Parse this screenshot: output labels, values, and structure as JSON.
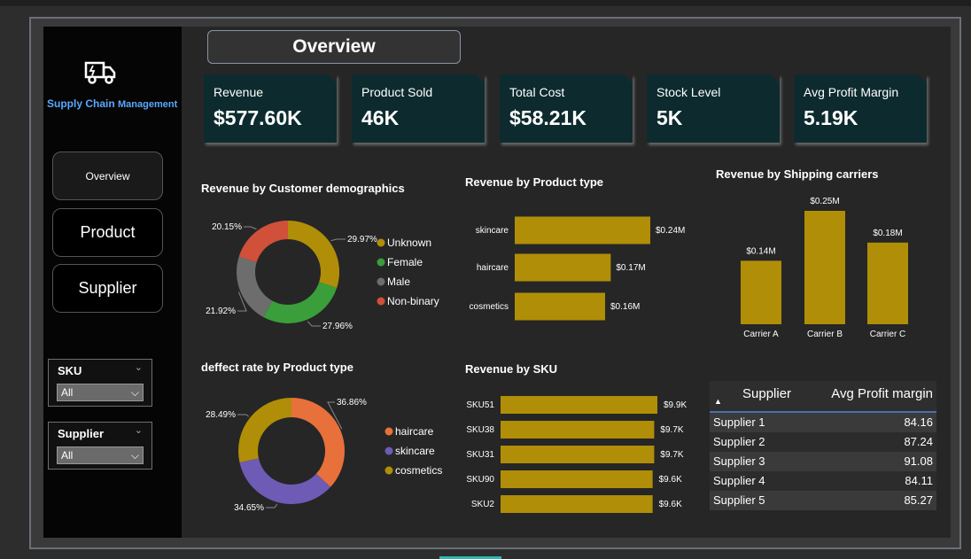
{
  "page": {
    "title": "Overview"
  },
  "brand": {
    "name": "Supply Chain",
    "sub": "Management",
    "icon": "delivery-truck-icon"
  },
  "nav": [
    {
      "label": "Overview",
      "active": true
    },
    {
      "label": "Product",
      "active": false
    },
    {
      "label": "Supplier",
      "active": false
    }
  ],
  "slicers": [
    {
      "label": "SKU",
      "value": "All"
    },
    {
      "label": "Supplier",
      "value": "All"
    }
  ],
  "kpis": [
    {
      "title": "Revenue",
      "value": "$577.60K"
    },
    {
      "title": "Product Sold",
      "value": "46K"
    },
    {
      "title": "Total Cost",
      "value": "$58.21K"
    },
    {
      "title": "Stock Level",
      "value": "5K"
    },
    {
      "title": "Avg Profit Margin",
      "value": "5.19K"
    }
  ],
  "colors": {
    "gold": "#b08e07",
    "kpi_bg": "#0d2b2e",
    "green": "#3a9e3a",
    "grey": "#6d6d6d",
    "red": "#d0503a",
    "orange": "#e8703a",
    "purple": "#6e5bb5"
  },
  "chart_data": [
    {
      "type": "pie",
      "title": "Revenue by Customer demographics",
      "labels": [
        "Unknown",
        "Female",
        "Male",
        "Non-binary"
      ],
      "values": [
        29.97,
        27.96,
        21.92,
        20.15
      ],
      "data_labels": [
        "29.97%",
        "27.96%",
        "21.92%",
        "20.15%"
      ],
      "colors": [
        "#b08e07",
        "#3a9e3a",
        "#6d6d6d",
        "#d0503a"
      ],
      "legend": "right"
    },
    {
      "type": "bar",
      "orientation": "horizontal",
      "title": "Revenue by Product type",
      "categories": [
        "skincare",
        "haircare",
        "cosmetics"
      ],
      "values": [
        0.24,
        0.17,
        0.16
      ],
      "data_labels": [
        "$0.24M",
        "$0.17M",
        "$0.16M"
      ],
      "xlim": [
        0,
        0.3
      ]
    },
    {
      "type": "bar",
      "orientation": "vertical",
      "title": "Revenue by Shipping carriers",
      "categories": [
        "Carrier A",
        "Carrier B",
        "Carrier C"
      ],
      "values": [
        0.14,
        0.25,
        0.18
      ],
      "data_labels": [
        "$0.14M",
        "$0.25M",
        "$0.18M"
      ],
      "ylim": [
        0,
        0.25
      ]
    },
    {
      "type": "pie",
      "title": "deffect rate by Product type",
      "labels": [
        "haircare",
        "skincare",
        "cosmetics"
      ],
      "values": [
        36.86,
        34.65,
        28.49
      ],
      "data_labels": [
        "36.86%",
        "34.65%",
        "28.49%"
      ],
      "colors": [
        "#e8703a",
        "#6e5bb5",
        "#b08e07"
      ],
      "legend": "right"
    },
    {
      "type": "bar",
      "orientation": "horizontal",
      "title": "Revenue by SKU",
      "categories": [
        "SKU51",
        "SKU38",
        "SKU31",
        "SKU90",
        "SKU2"
      ],
      "values": [
        9.9,
        9.7,
        9.7,
        9.6,
        9.6
      ],
      "data_labels": [
        "$9.9K",
        "$9.7K",
        "$9.7K",
        "$9.6K",
        "$9.6K"
      ],
      "xlim": [
        0,
        10
      ]
    },
    {
      "type": "table",
      "columns": [
        "Supplier",
        "Avg Profit margin"
      ],
      "rows": [
        [
          "Supplier 1",
          "84.16"
        ],
        [
          "Supplier 2",
          "87.24"
        ],
        [
          "Supplier 3",
          "91.08"
        ],
        [
          "Supplier 4",
          "84.11"
        ],
        [
          "Supplier 5",
          "85.27"
        ]
      ]
    }
  ]
}
